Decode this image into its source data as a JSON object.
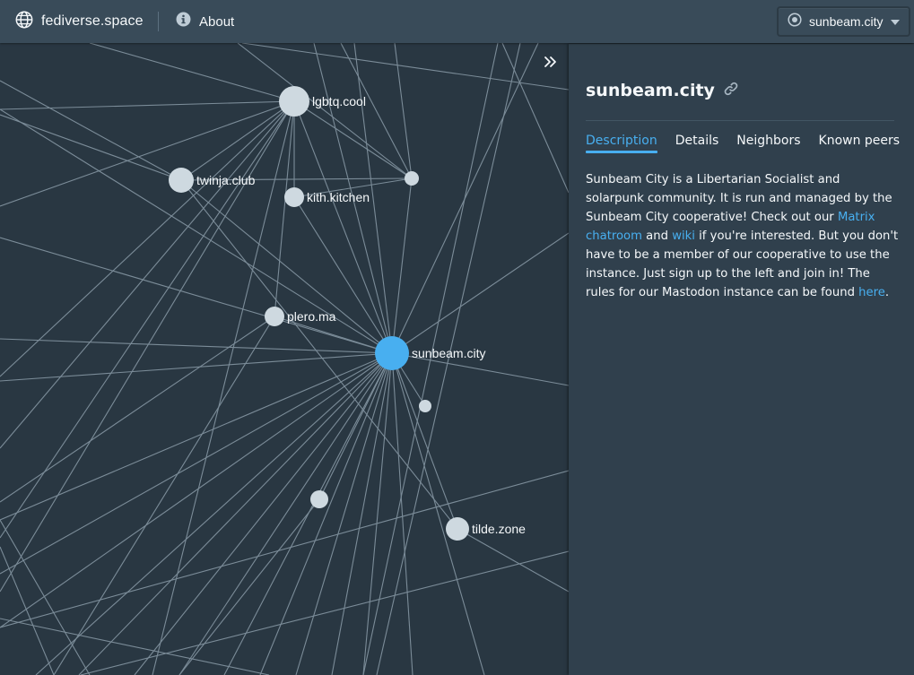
{
  "navbar": {
    "brand": "fediverse.space",
    "about": "About",
    "selected_instance": "sunbeam.city"
  },
  "graph": {
    "selected_node": "sunbeam.city",
    "nodes": [
      {
        "id": "lgbtq.cool",
        "label": "lgbtq.cool"
      },
      {
        "id": "twinja.club",
        "label": "twinja.club"
      },
      {
        "id": "kith.kitchen",
        "label": "kith.kitchen"
      },
      {
        "id": "plero.ma",
        "label": "plero.ma"
      },
      {
        "id": "sunbeam.city",
        "label": "sunbeam.city"
      },
      {
        "id": "tilde.zone",
        "label": "tilde.zone"
      },
      {
        "id": "unlabeled-1",
        "label": ""
      },
      {
        "id": "unlabeled-2",
        "label": ""
      },
      {
        "id": "unlabeled-3",
        "label": ""
      }
    ],
    "colors": {
      "background": "#293742",
      "edge": "#8a9ba8",
      "node": "#ced9e0",
      "selected": "#48aff0"
    }
  },
  "sidebar": {
    "title": "sunbeam.city",
    "tabs": [
      {
        "label": "Description",
        "active": true
      },
      {
        "label": "Details",
        "active": false
      },
      {
        "label": "Neighbors",
        "active": false
      },
      {
        "label": "Known peers",
        "active": false
      }
    ],
    "description": {
      "p1": "Sunbeam City is a Libertarian Socialist and solarpunk community. It is run and managed by the Sunbeam City cooperative! Check out our ",
      "link1": "Matrix chatroom",
      "p2": " and ",
      "link2": "wiki",
      "p3": " if you're interested. But you don't have to be a member of our cooperative to use the instance. Just sign up to the left and join in! The rules for our Mastodon instance can be found ",
      "link3": "here",
      "p4": "."
    }
  }
}
